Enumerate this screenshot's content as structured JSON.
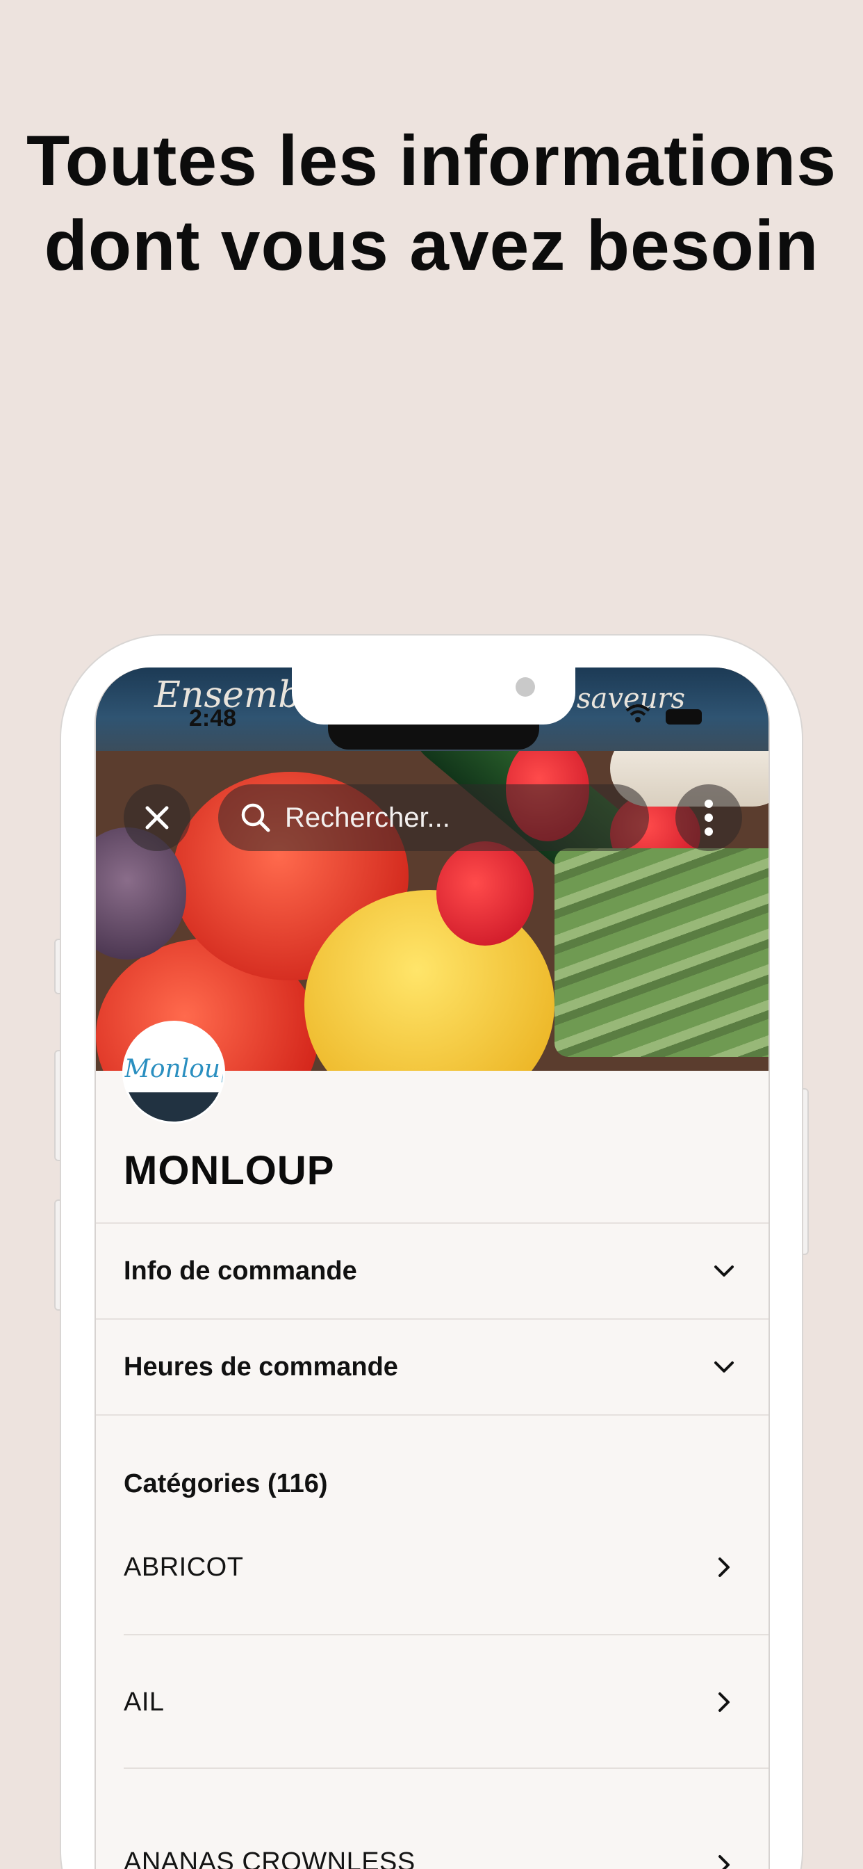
{
  "headline": {
    "line1": "Toutes les informations",
    "line2": "dont vous avez besoin"
  },
  "status_bar": {
    "time": "2:48"
  },
  "hero": {
    "sign_left": "Ensemb",
    "sign_right": "saveurs",
    "search_placeholder": "Rechercher..."
  },
  "shop": {
    "logo_text": "Monloup",
    "name": "MONLOUP"
  },
  "accordions": [
    {
      "label": "Info de commande"
    },
    {
      "label": "Heures de commande"
    }
  ],
  "categories": {
    "title": "Catégories (116)",
    "items": [
      "ABRICOT",
      "AIL",
      "ANANAS CROWNLESS"
    ]
  },
  "colors": {
    "background": "#ede3de",
    "screen_background": "#f9f6f4",
    "logo_blue": "#2a8fc0"
  }
}
